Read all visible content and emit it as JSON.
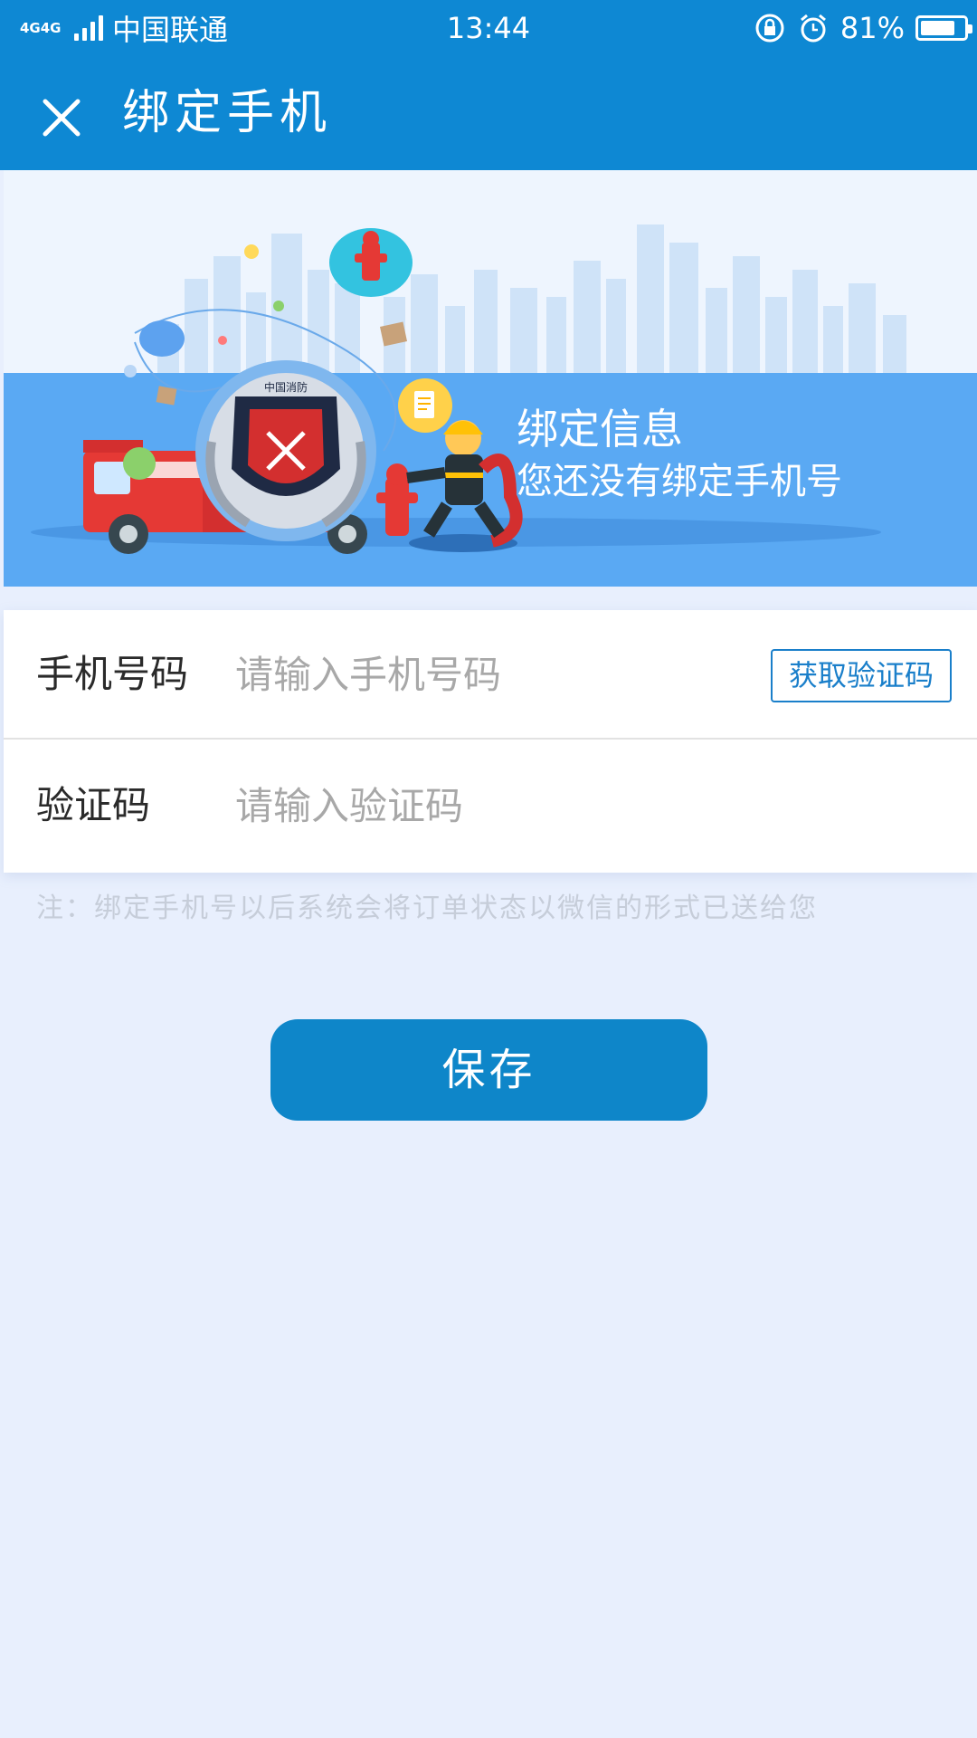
{
  "status_bar": {
    "network": "4G4G",
    "carrier": "中国联通",
    "time": "13:44",
    "battery_percent": "81%",
    "battery_level": 0.81,
    "icons": [
      "signal-icon",
      "rotation-lock-icon",
      "alarm-icon",
      "battery-icon"
    ]
  },
  "header": {
    "title": "绑定手机",
    "close_icon": "close-icon"
  },
  "banner": {
    "title": "绑定信息",
    "subtitle": "您还没有绑定手机号",
    "badge_text": "中国消防"
  },
  "form": {
    "phone": {
      "label": "手机号码",
      "placeholder": "请输入手机号码",
      "value": "",
      "get_code_label": "获取验证码"
    },
    "code": {
      "label": "验证码",
      "placeholder": "请输入验证码",
      "value": ""
    },
    "note": "注：绑定手机号以后系统会将订单状态以微信的形式已送给您"
  },
  "actions": {
    "save_label": "保存"
  },
  "colors": {
    "header": "#0e88d3",
    "banner_band": "#5aa9f3",
    "page_background": "#e8effd",
    "button": "#0e86c9"
  }
}
